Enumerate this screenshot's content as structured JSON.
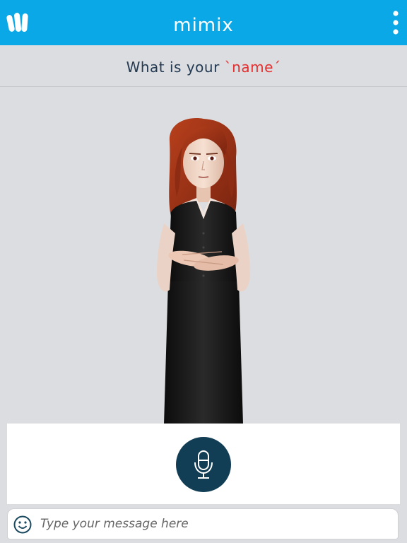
{
  "header": {
    "title": "mimix",
    "background_color": "#0aa8e6",
    "logo_icon": "hand-logo-icon",
    "menu_icon": "vertical-dots-menu-icon"
  },
  "prompt": {
    "text": "What is your",
    "highlight": "`name´",
    "highlight_color": "#e23030"
  },
  "avatar": {
    "icon": "sign-language-avatar"
  },
  "mic": {
    "icon": "microphone-icon",
    "color": "#123e55"
  },
  "message": {
    "placeholder": "Type your message here",
    "value": "",
    "emoji_icon": "smiley-icon"
  }
}
